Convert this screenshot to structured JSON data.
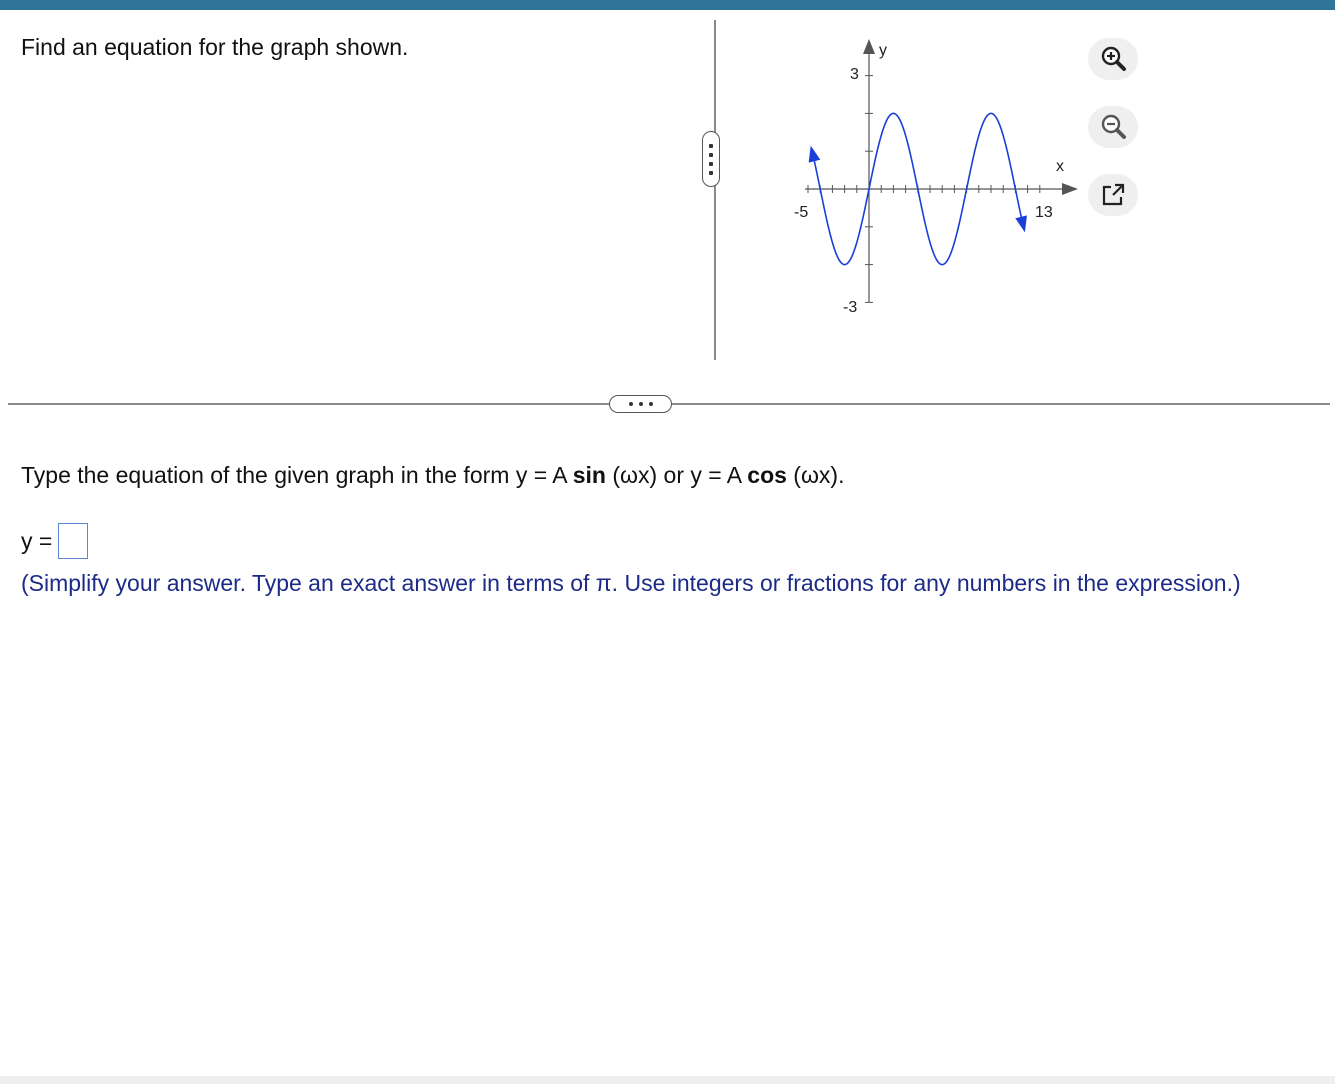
{
  "question": "Find an equation for the graph shown.",
  "graph": {
    "y_axis_label": "y",
    "x_axis_label": "x",
    "y_max_label": "3",
    "y_min_label": "-3",
    "x_min_label": "-5",
    "x_max_label": "13",
    "curve_color": "#1a3fd6",
    "axis_color": "#555555"
  },
  "tools": {
    "zoom_in": "zoom-in-icon",
    "zoom_out": "zoom-out-icon",
    "popout": "popout-icon"
  },
  "instruction": {
    "prefix": "Type the equation of the given graph in the form y = A ",
    "sin": "sin",
    "middle": " (ωx) or y = A ",
    "cos": "cos",
    "suffix": " (ωx)."
  },
  "answer": {
    "label": "y =",
    "value": ""
  },
  "hint": "(Simplify your answer. Type an exact answer in terms of π. Use integers or fractions for any numbers in the expression.)",
  "colors": {
    "top_bar": "#317699",
    "hint_text": "#1c2b87",
    "input_border": "#5b87d6"
  }
}
